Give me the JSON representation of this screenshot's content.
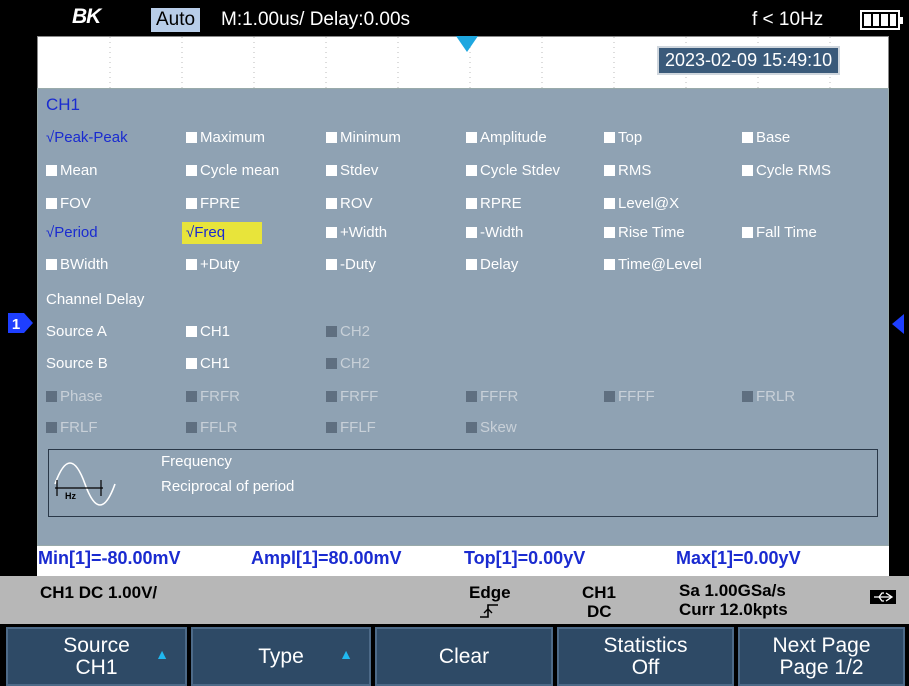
{
  "status": {
    "logo": "BK",
    "mode": "Auto",
    "timebase": "M:1.00us/ Delay:0.00s",
    "frequency": "f < 10Hz"
  },
  "datetime": "2023-02-09 15:49:10",
  "panel": {
    "title": "CH1",
    "rows": [
      [
        "√Peak-Peak",
        "Maximum",
        "Minimum",
        "Amplitude",
        "Top",
        "Base"
      ],
      [
        "Mean",
        "Cycle mean",
        "Stdev",
        "Cycle Stdev",
        "RMS",
        "Cycle RMS"
      ],
      [
        "FOV",
        "FPRE",
        "ROV",
        "RPRE",
        "Level@X",
        ""
      ],
      [
        "√Period",
        "√Freq",
        "+Width",
        "-Width",
        "Rise Time",
        "Fall Time"
      ],
      [
        "BWidth",
        "+Duty",
        "-Duty",
        "Delay",
        "Time@Level",
        ""
      ]
    ],
    "channel_delay_label": "Channel Delay",
    "source_a_label": "Source A",
    "source_b_label": "Source B",
    "source_options": [
      "CH1",
      "CH2"
    ],
    "delay_rows": [
      [
        "Phase",
        "FRFR",
        "FRFF",
        "FFFR",
        "FFFF",
        "FRLR"
      ],
      [
        "FRLF",
        "FFLR",
        "FFLF",
        "Skew",
        "",
        ""
      ]
    ],
    "description": {
      "name": "Frequency",
      "text": "Reciprocal of period",
      "waveform_unit": "Hz"
    }
  },
  "channel_marker": "1",
  "measurements": [
    "Min[1]=-80.00mV",
    "Ampl[1]=80.00mV",
    "Top[1]=0.00yV",
    "Max[1]=0.00yV"
  ],
  "info": {
    "channel": "CH1 DC 1.00V/",
    "trigger_type": "Edge",
    "trigger_source": "CH1",
    "trigger_coupling": "DC",
    "sample_rate": "Sa 1.00GSa/s",
    "memory": "Curr 12.0kpts"
  },
  "softkeys": [
    {
      "line1": "Source",
      "line2": "CH1"
    },
    {
      "line1": "Type",
      "line2": ""
    },
    {
      "line1": "Clear",
      "line2": ""
    },
    {
      "line1": "Statistics",
      "line2": "Off"
    },
    {
      "line1": "Next Page",
      "line2": "Page 1/2"
    }
  ],
  "colors": {
    "panel_bg": "#8fa2b3",
    "selected_text": "#1a2bd0",
    "highlight": "#e8e43a",
    "softkey_bg": "#2e4a66",
    "trigger_marker": "#1ea7e0"
  }
}
